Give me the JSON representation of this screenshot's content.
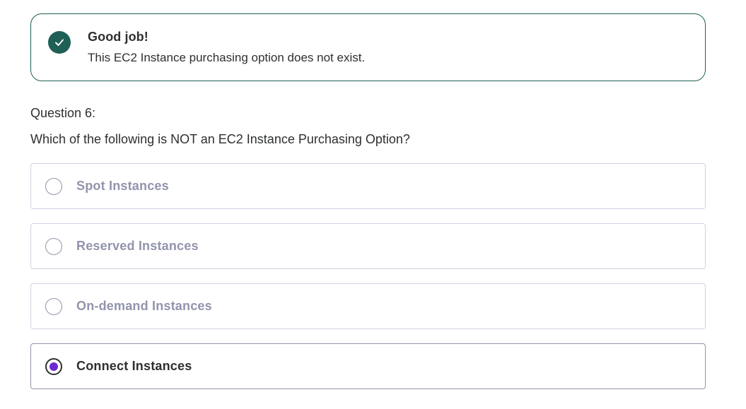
{
  "feedback": {
    "icon": "checkmark-icon",
    "title": "Good job!",
    "message": "This EC2 Instance purchasing option does not exist.",
    "color": "#1e6055"
  },
  "question": {
    "label": "Question 6:",
    "text": "Which of the following is NOT an EC2 Instance Purchasing Option?"
  },
  "options": [
    {
      "label": "Spot Instances",
      "selected": false
    },
    {
      "label": "Reserved Instances",
      "selected": false
    },
    {
      "label": "On-demand Instances",
      "selected": false
    },
    {
      "label": "Connect Instances",
      "selected": true
    }
  ],
  "colors": {
    "accent": "#6d28d2",
    "disabled_text": "#9194ac",
    "text": "#2d2f31"
  }
}
